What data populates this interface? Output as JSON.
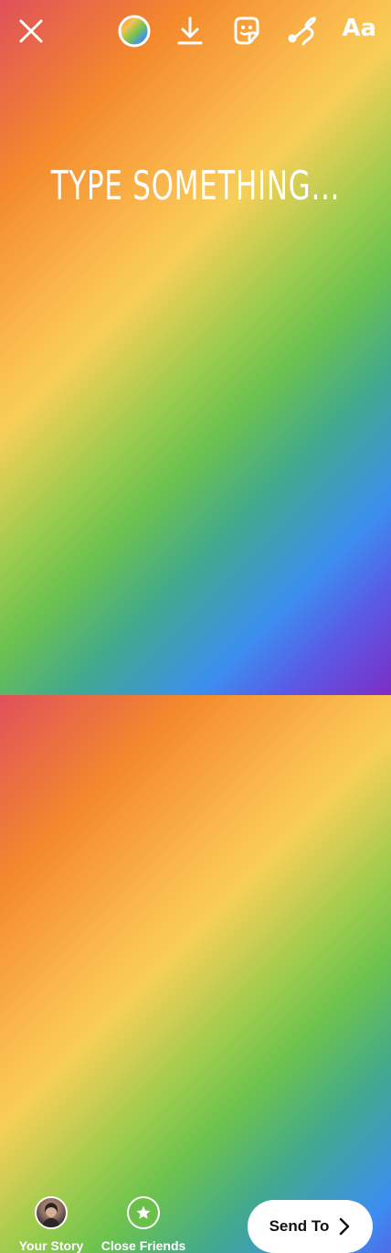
{
  "top_toolbar": {
    "text_tool_label": "Aa"
  },
  "canvas": {
    "placeholder_text": "TYPE SOMETHING..."
  },
  "share_targets": [
    {
      "label": "Your Story"
    },
    {
      "label": "Close Friends"
    }
  ],
  "send_button": {
    "label": "Send To"
  },
  "colors": {
    "close_friends_green": "#6bc04b",
    "send_button_bg": "#ffffff"
  }
}
